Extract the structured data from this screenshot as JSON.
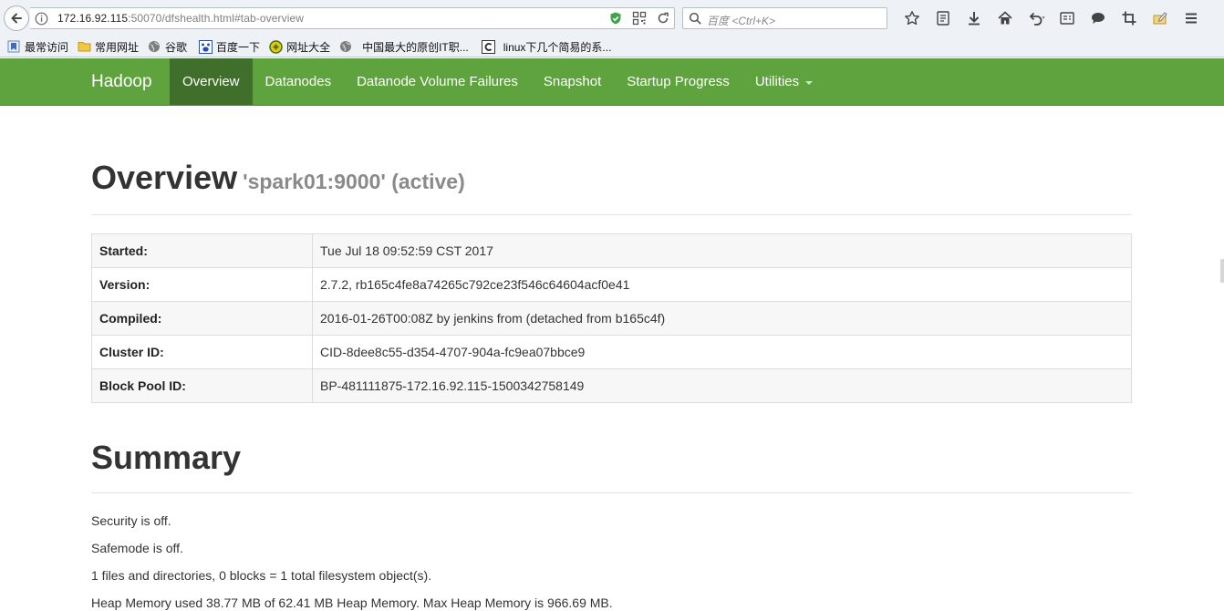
{
  "browser": {
    "url_host": "172.16.92.115",
    "url_rest": ":50070/dfshealth.html#tab-overview",
    "search_placeholder": "百度 <Ctrl+K>",
    "bookmarks": [
      {
        "label": "最常访问",
        "icon": "bookmark-star-icon"
      },
      {
        "label": "常用网址",
        "icon": "folder-icon"
      },
      {
        "label": "谷歌",
        "icon": "globe-icon"
      },
      {
        "label": "百度一下",
        "icon": "baidu-paw-icon"
      },
      {
        "label": "网址大全",
        "icon": "hao123-icon"
      },
      {
        "label": "中国最大的原创IT职...",
        "icon": "globe-icon"
      },
      {
        "label": "linux下几个简易的系...",
        "icon": "c-logo-icon"
      }
    ]
  },
  "navbar": {
    "brand": "Hadoop",
    "items": [
      {
        "label": "Overview",
        "active": true
      },
      {
        "label": "Datanodes"
      },
      {
        "label": "Datanode Volume Failures"
      },
      {
        "label": "Snapshot"
      },
      {
        "label": "Startup Progress"
      },
      {
        "label": "Utilities",
        "dropdown": true
      }
    ],
    "colors": {
      "bar": "#5fa33e",
      "active": "#3f6f2a"
    }
  },
  "overview": {
    "title": "Overview",
    "subtitle": "'spark01:9000' (active)",
    "rows": [
      {
        "key": "Started:",
        "value": "Tue Jul 18 09:52:59 CST 2017"
      },
      {
        "key": "Version:",
        "value": "2.7.2, rb165c4fe8a74265c792ce23f546c64604acf0e41"
      },
      {
        "key": "Compiled:",
        "value": "2016-01-26T00:08Z by jenkins from (detached from b165c4f)"
      },
      {
        "key": "Cluster ID:",
        "value": "CID-8dee8c55-d354-4707-904a-fc9ea07bbce9"
      },
      {
        "key": "Block Pool ID:",
        "value": "BP-481111875-172.16.92.115-1500342758149"
      }
    ]
  },
  "summary": {
    "title": "Summary",
    "lines": [
      "Security is off.",
      "Safemode is off.",
      "1 files and directories, 0 blocks = 1 total filesystem object(s).",
      "Heap Memory used 38.77 MB of 62.41 MB Heap Memory. Max Heap Memory is 966.69 MB."
    ]
  }
}
